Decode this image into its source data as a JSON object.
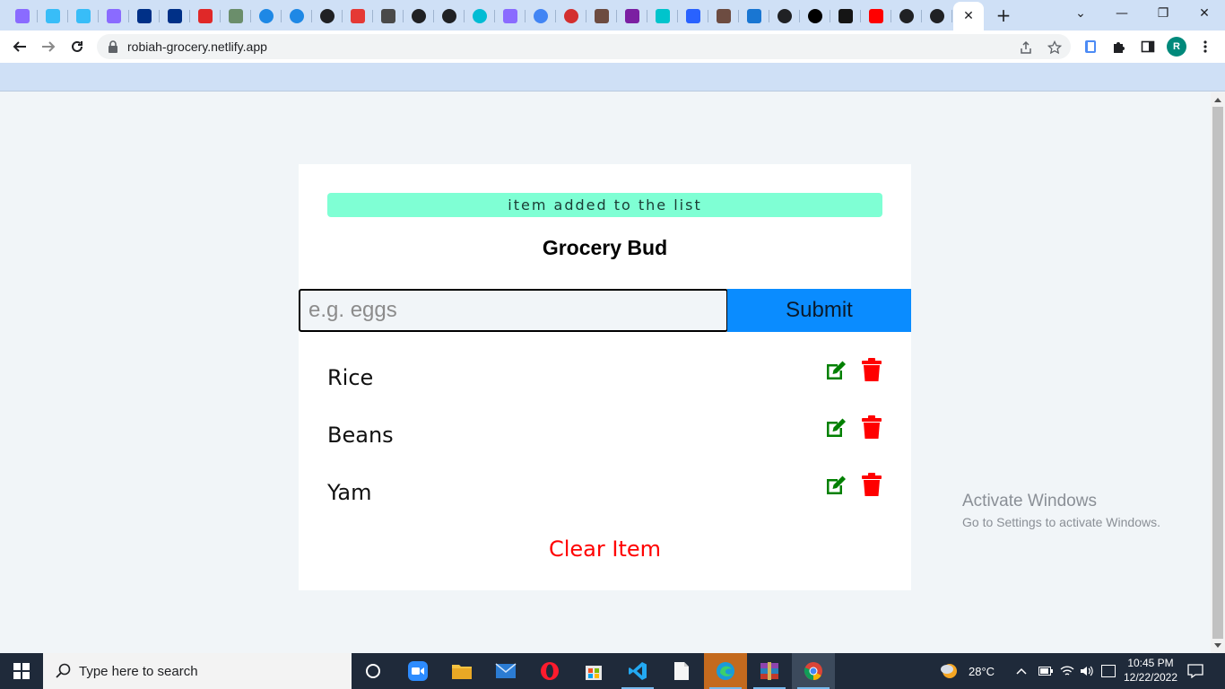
{
  "browser": {
    "tab_favicons": [
      "vite-icon",
      "tailwind-icon",
      "tailwind-icon",
      "vite-icon",
      "paypal-icon",
      "paypal-icon",
      "netlify-icon",
      "scissors-icon",
      "codeium-icon",
      "codeium-icon",
      "globe-icon",
      "pen-icon",
      "chrome-icon",
      "globe-icon",
      "globe-icon",
      "circle-icon",
      "vite-icon",
      "google-icon",
      "record-icon",
      "avatar-icon",
      "chart-icon",
      "twitch-icon",
      "blue-app-icon",
      "avatar-icon",
      "note-icon",
      "globe-icon",
      "github-icon",
      "codesandbox-icon",
      "youtube-icon",
      "globe-icon",
      "globe-icon"
    ],
    "url": "robiah-grocery.netlify.app",
    "profile_initial": "R"
  },
  "app": {
    "alert": "item added to the list",
    "title": "Grocery Bud",
    "input_placeholder": "e.g. eggs",
    "input_value": "",
    "submit_label": "Submit",
    "items": [
      {
        "name": "Rice"
      },
      {
        "name": "Beans"
      },
      {
        "name": "Yam"
      }
    ],
    "clear_label": "Clear Item",
    "colors": {
      "alert_bg": "#7fffd4",
      "submit_bg": "#0a8cff",
      "edit": "#008000",
      "delete": "#ff0000",
      "clear": "#ff0000"
    }
  },
  "watermark": {
    "line1": "Activate Windows",
    "line2": "Go to Settings to activate Windows."
  },
  "taskbar": {
    "search_placeholder": "Type here to search",
    "weather": "28°C",
    "time": "10:45 PM",
    "date": "12/22/2022"
  }
}
